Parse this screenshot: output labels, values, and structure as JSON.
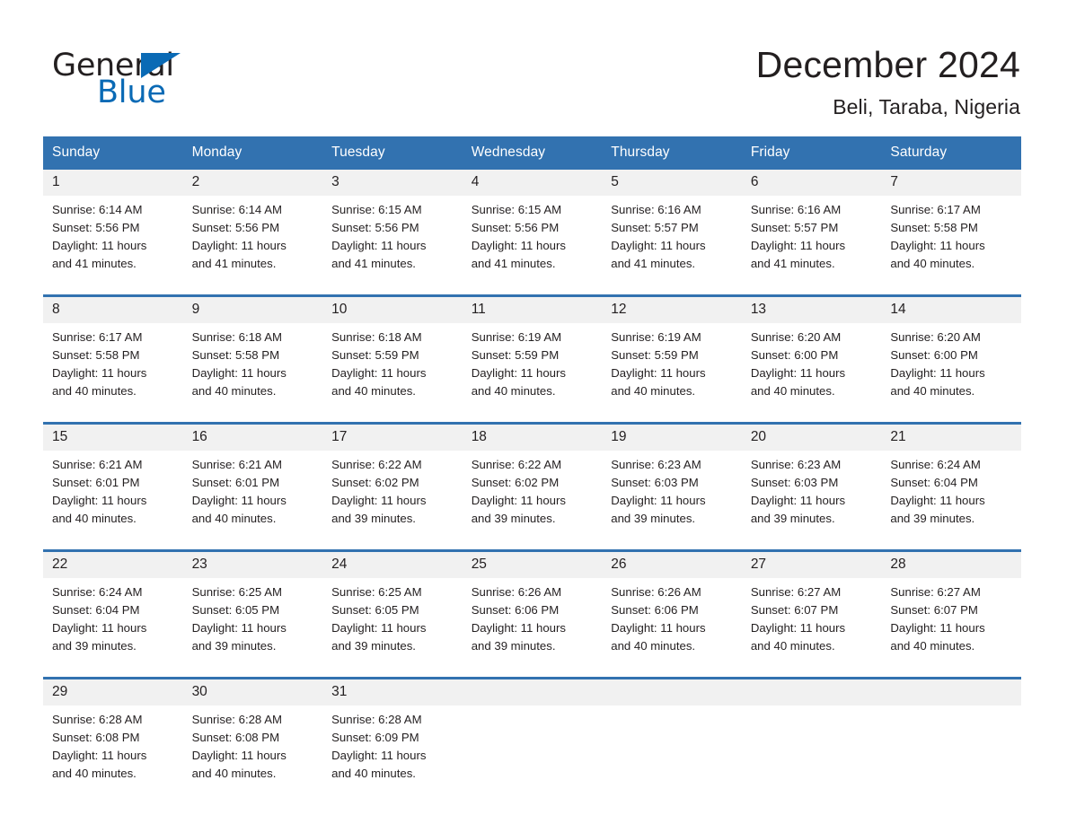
{
  "brand": {
    "name_part1": "General",
    "name_part2": "Blue",
    "triangle_color": "#0a6ab5"
  },
  "header": {
    "month_title": "December 2024",
    "location": "Beli, Taraba, Nigeria",
    "accent_color": "#3272b0",
    "daynum_band_color": "#f1f1f1"
  },
  "weekdays": [
    "Sunday",
    "Monday",
    "Tuesday",
    "Wednesday",
    "Thursday",
    "Friday",
    "Saturday"
  ],
  "labels": {
    "sunrise_prefix": "Sunrise:",
    "sunset_prefix": "Sunset:",
    "daylight_prefix": "Daylight:"
  },
  "weeks": [
    {
      "days": [
        {
          "date": "1",
          "sunrise_line": "Sunrise: 6:14 AM",
          "sunset_line": "Sunset: 5:56 PM",
          "daylight_line1": "Daylight: 11 hours",
          "daylight_line2": "and 41 minutes."
        },
        {
          "date": "2",
          "sunrise_line": "Sunrise: 6:14 AM",
          "sunset_line": "Sunset: 5:56 PM",
          "daylight_line1": "Daylight: 11 hours",
          "daylight_line2": "and 41 minutes."
        },
        {
          "date": "3",
          "sunrise_line": "Sunrise: 6:15 AM",
          "sunset_line": "Sunset: 5:56 PM",
          "daylight_line1": "Daylight: 11 hours",
          "daylight_line2": "and 41 minutes."
        },
        {
          "date": "4",
          "sunrise_line": "Sunrise: 6:15 AM",
          "sunset_line": "Sunset: 5:56 PM",
          "daylight_line1": "Daylight: 11 hours",
          "daylight_line2": "and 41 minutes."
        },
        {
          "date": "5",
          "sunrise_line": "Sunrise: 6:16 AM",
          "sunset_line": "Sunset: 5:57 PM",
          "daylight_line1": "Daylight: 11 hours",
          "daylight_line2": "and 41 minutes."
        },
        {
          "date": "6",
          "sunrise_line": "Sunrise: 6:16 AM",
          "sunset_line": "Sunset: 5:57 PM",
          "daylight_line1": "Daylight: 11 hours",
          "daylight_line2": "and 41 minutes."
        },
        {
          "date": "7",
          "sunrise_line": "Sunrise: 6:17 AM",
          "sunset_line": "Sunset: 5:58 PM",
          "daylight_line1": "Daylight: 11 hours",
          "daylight_line2": "and 40 minutes."
        }
      ]
    },
    {
      "days": [
        {
          "date": "8",
          "sunrise_line": "Sunrise: 6:17 AM",
          "sunset_line": "Sunset: 5:58 PM",
          "daylight_line1": "Daylight: 11 hours",
          "daylight_line2": "and 40 minutes."
        },
        {
          "date": "9",
          "sunrise_line": "Sunrise: 6:18 AM",
          "sunset_line": "Sunset: 5:58 PM",
          "daylight_line1": "Daylight: 11 hours",
          "daylight_line2": "and 40 minutes."
        },
        {
          "date": "10",
          "sunrise_line": "Sunrise: 6:18 AM",
          "sunset_line": "Sunset: 5:59 PM",
          "daylight_line1": "Daylight: 11 hours",
          "daylight_line2": "and 40 minutes."
        },
        {
          "date": "11",
          "sunrise_line": "Sunrise: 6:19 AM",
          "sunset_line": "Sunset: 5:59 PM",
          "daylight_line1": "Daylight: 11 hours",
          "daylight_line2": "and 40 minutes."
        },
        {
          "date": "12",
          "sunrise_line": "Sunrise: 6:19 AM",
          "sunset_line": "Sunset: 5:59 PM",
          "daylight_line1": "Daylight: 11 hours",
          "daylight_line2": "and 40 minutes."
        },
        {
          "date": "13",
          "sunrise_line": "Sunrise: 6:20 AM",
          "sunset_line": "Sunset: 6:00 PM",
          "daylight_line1": "Daylight: 11 hours",
          "daylight_line2": "and 40 minutes."
        },
        {
          "date": "14",
          "sunrise_line": "Sunrise: 6:20 AM",
          "sunset_line": "Sunset: 6:00 PM",
          "daylight_line1": "Daylight: 11 hours",
          "daylight_line2": "and 40 minutes."
        }
      ]
    },
    {
      "days": [
        {
          "date": "15",
          "sunrise_line": "Sunrise: 6:21 AM",
          "sunset_line": "Sunset: 6:01 PM",
          "daylight_line1": "Daylight: 11 hours",
          "daylight_line2": "and 40 minutes."
        },
        {
          "date": "16",
          "sunrise_line": "Sunrise: 6:21 AM",
          "sunset_line": "Sunset: 6:01 PM",
          "daylight_line1": "Daylight: 11 hours",
          "daylight_line2": "and 40 minutes."
        },
        {
          "date": "17",
          "sunrise_line": "Sunrise: 6:22 AM",
          "sunset_line": "Sunset: 6:02 PM",
          "daylight_line1": "Daylight: 11 hours",
          "daylight_line2": "and 39 minutes."
        },
        {
          "date": "18",
          "sunrise_line": "Sunrise: 6:22 AM",
          "sunset_line": "Sunset: 6:02 PM",
          "daylight_line1": "Daylight: 11 hours",
          "daylight_line2": "and 39 minutes."
        },
        {
          "date": "19",
          "sunrise_line": "Sunrise: 6:23 AM",
          "sunset_line": "Sunset: 6:03 PM",
          "daylight_line1": "Daylight: 11 hours",
          "daylight_line2": "and 39 minutes."
        },
        {
          "date": "20",
          "sunrise_line": "Sunrise: 6:23 AM",
          "sunset_line": "Sunset: 6:03 PM",
          "daylight_line1": "Daylight: 11 hours",
          "daylight_line2": "and 39 minutes."
        },
        {
          "date": "21",
          "sunrise_line": "Sunrise: 6:24 AM",
          "sunset_line": "Sunset: 6:04 PM",
          "daylight_line1": "Daylight: 11 hours",
          "daylight_line2": "and 39 minutes."
        }
      ]
    },
    {
      "days": [
        {
          "date": "22",
          "sunrise_line": "Sunrise: 6:24 AM",
          "sunset_line": "Sunset: 6:04 PM",
          "daylight_line1": "Daylight: 11 hours",
          "daylight_line2": "and 39 minutes."
        },
        {
          "date": "23",
          "sunrise_line": "Sunrise: 6:25 AM",
          "sunset_line": "Sunset: 6:05 PM",
          "daylight_line1": "Daylight: 11 hours",
          "daylight_line2": "and 39 minutes."
        },
        {
          "date": "24",
          "sunrise_line": "Sunrise: 6:25 AM",
          "sunset_line": "Sunset: 6:05 PM",
          "daylight_line1": "Daylight: 11 hours",
          "daylight_line2": "and 39 minutes."
        },
        {
          "date": "25",
          "sunrise_line": "Sunrise: 6:26 AM",
          "sunset_line": "Sunset: 6:06 PM",
          "daylight_line1": "Daylight: 11 hours",
          "daylight_line2": "and 39 minutes."
        },
        {
          "date": "26",
          "sunrise_line": "Sunrise: 6:26 AM",
          "sunset_line": "Sunset: 6:06 PM",
          "daylight_line1": "Daylight: 11 hours",
          "daylight_line2": "and 40 minutes."
        },
        {
          "date": "27",
          "sunrise_line": "Sunrise: 6:27 AM",
          "sunset_line": "Sunset: 6:07 PM",
          "daylight_line1": "Daylight: 11 hours",
          "daylight_line2": "and 40 minutes."
        },
        {
          "date": "28",
          "sunrise_line": "Sunrise: 6:27 AM",
          "sunset_line": "Sunset: 6:07 PM",
          "daylight_line1": "Daylight: 11 hours",
          "daylight_line2": "and 40 minutes."
        }
      ]
    },
    {
      "days": [
        {
          "date": "29",
          "sunrise_line": "Sunrise: 6:28 AM",
          "sunset_line": "Sunset: 6:08 PM",
          "daylight_line1": "Daylight: 11 hours",
          "daylight_line2": "and 40 minutes."
        },
        {
          "date": "30",
          "sunrise_line": "Sunrise: 6:28 AM",
          "sunset_line": "Sunset: 6:08 PM",
          "daylight_line1": "Daylight: 11 hours",
          "daylight_line2": "and 40 minutes."
        },
        {
          "date": "31",
          "sunrise_line": "Sunrise: 6:28 AM",
          "sunset_line": "Sunset: 6:09 PM",
          "daylight_line1": "Daylight: 11 hours",
          "daylight_line2": "and 40 minutes."
        },
        {
          "date": "",
          "sunrise_line": "",
          "sunset_line": "",
          "daylight_line1": "",
          "daylight_line2": ""
        },
        {
          "date": "",
          "sunrise_line": "",
          "sunset_line": "",
          "daylight_line1": "",
          "daylight_line2": ""
        },
        {
          "date": "",
          "sunrise_line": "",
          "sunset_line": "",
          "daylight_line1": "",
          "daylight_line2": ""
        },
        {
          "date": "",
          "sunrise_line": "",
          "sunset_line": "",
          "daylight_line1": "",
          "daylight_line2": ""
        }
      ]
    }
  ]
}
